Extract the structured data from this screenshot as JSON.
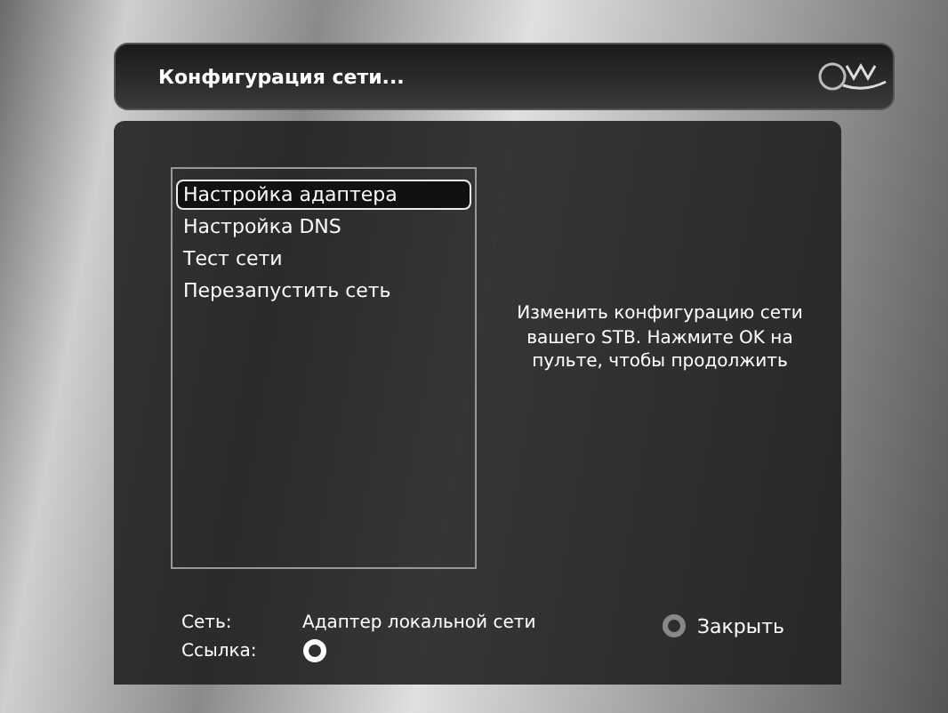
{
  "title_bar": {
    "title": "Конфигурация сети..."
  },
  "menu": {
    "items": [
      {
        "label": "Настройка адаптера",
        "selected": true
      },
      {
        "label": "Настройка DNS",
        "selected": false
      },
      {
        "label": "Тест сети",
        "selected": false
      },
      {
        "label": "Перезапустить сеть",
        "selected": false
      }
    ]
  },
  "description": "Изменить конфигурацию сети вашего STB. Нажмите OK на пульте, чтобы продолжить",
  "status": {
    "network_label": "Сеть:",
    "network_value": "Адаптер локальной сети",
    "link_label": "Ссылка:"
  },
  "close_button": {
    "label": "Закрыть"
  }
}
